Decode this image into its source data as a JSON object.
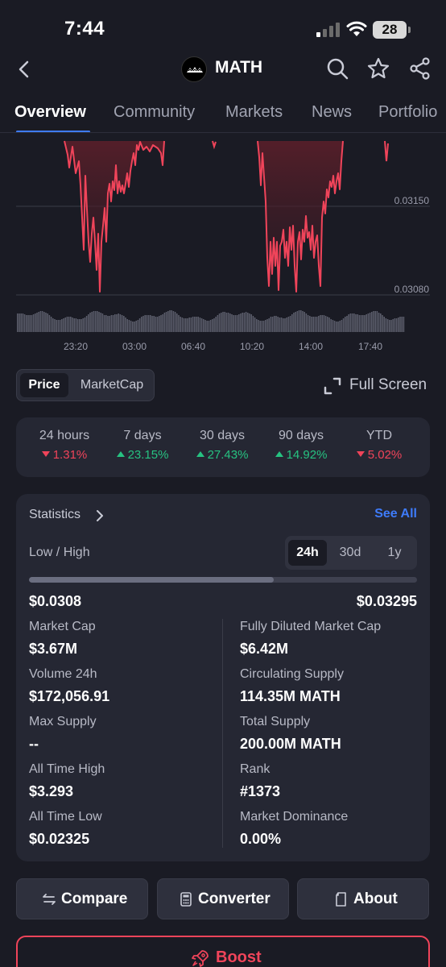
{
  "status_bar": {
    "time": "7:44",
    "battery": "28"
  },
  "header": {
    "coin_name": "MATH",
    "icons": [
      "back-icon",
      "search-icon",
      "star-icon",
      "share-icon"
    ]
  },
  "tabs": [
    {
      "label": "Overview",
      "active": true
    },
    {
      "label": "Community",
      "active": false
    },
    {
      "label": "Markets",
      "active": false
    },
    {
      "label": "News",
      "active": false
    },
    {
      "label": "Portfolio",
      "active": false
    }
  ],
  "chart_data": {
    "type": "area",
    "x_ticks": [
      "23:20",
      "03:00",
      "06:40",
      "10:20",
      "14:00",
      "17:40"
    ],
    "y_ticks": [
      "0.03150",
      "0.03080"
    ],
    "line_color": "#f0445a",
    "has_volume_bars": true
  },
  "chart_toggle": {
    "options": [
      "Price",
      "MarketCap"
    ],
    "selected": "Price"
  },
  "fullscreen_label": "Full Screen",
  "performance": [
    {
      "label": "24 hours",
      "value": "1.31%",
      "direction": "down"
    },
    {
      "label": "7 days",
      "value": "23.15%",
      "direction": "up"
    },
    {
      "label": "30 days",
      "value": "27.43%",
      "direction": "up"
    },
    {
      "label": "90 days",
      "value": "14.92%",
      "direction": "up"
    },
    {
      "label": "YTD",
      "value": "5.02%",
      "direction": "down"
    }
  ],
  "statistics": {
    "title": "Statistics",
    "see_all": "See All",
    "low_high_label": "Low / High",
    "ranges": [
      "24h",
      "30d",
      "1y"
    ],
    "selected_range": "24h",
    "range_position": 0.63,
    "low": "$0.0308",
    "high": "$0.03295",
    "left": [
      {
        "label": "Market Cap",
        "value": "$3.67M"
      },
      {
        "label": "Volume 24h",
        "value": "$172,056.91"
      },
      {
        "label": "Max Supply",
        "value": "--"
      },
      {
        "label": "All Time High",
        "value": "$3.293"
      },
      {
        "label": "All Time Low",
        "value": "$0.02325"
      }
    ],
    "right": [
      {
        "label": "Fully Diluted Market Cap",
        "value": "$6.42M"
      },
      {
        "label": "Circulating Supply",
        "value": "114.35M MATH"
      },
      {
        "label": "Total Supply",
        "value": "200.00M MATH"
      },
      {
        "label": "Rank",
        "value": "#1373"
      },
      {
        "label": "Market Dominance",
        "value": "0.00%"
      }
    ]
  },
  "actions": [
    {
      "label": "Compare",
      "icon": "compare-icon"
    },
    {
      "label": "Converter",
      "icon": "calculator-icon"
    },
    {
      "label": "About",
      "icon": "document-icon"
    }
  ],
  "boost": {
    "label": "Boost",
    "icon": "rocket-icon",
    "color": "#f0445a"
  },
  "colors": {
    "background": "#1a1b24",
    "card": "#252733",
    "accent": "#3e7bfa",
    "up": "#26c281",
    "down": "#f0445a"
  }
}
